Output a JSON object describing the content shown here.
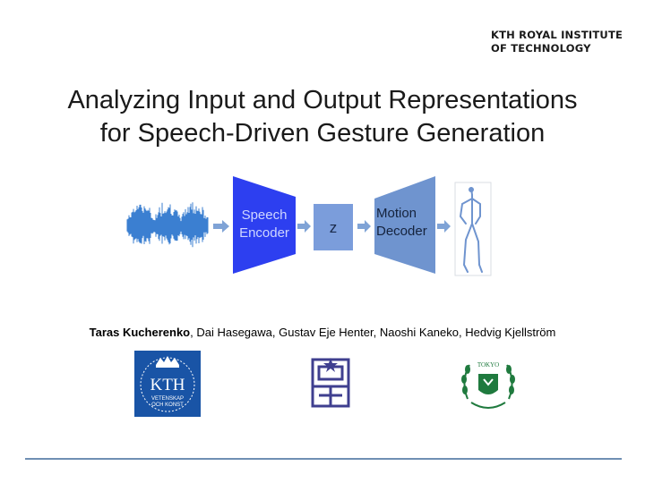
{
  "header": {
    "institution_line1": "KTH ROYAL INSTITUTE",
    "institution_line2": "OF TECHNOLOGY"
  },
  "title": {
    "line1": "Analyzing Input and Output Representations",
    "line2": "for Speech-Driven Gesture Generation"
  },
  "diagram": {
    "encoder_line1": "Speech",
    "encoder_line2": "Encoder",
    "latent": "z",
    "decoder_line1": "Motion",
    "decoder_line2": "Decoder"
  },
  "authors": {
    "lead": "Taras Kucherenko",
    "rest": ", Dai Hasegawa, Gustav Eje Henter, Naoshi Kaneko, Hedvig Kjellström"
  },
  "logos": {
    "kth_text": "KTH",
    "kth_sub1": "VETENSKAP",
    "kth_sub2": "OCH KONST",
    "tokyo_text": "TOKYO"
  },
  "colors": {
    "encoder": "#2d3ff0",
    "decoder": "#6f94cf",
    "latent": "#7b9ddb",
    "arrow": "#7fa3d6",
    "waveform": "#3b7fd1",
    "kth_blue": "#1954a6",
    "purple_logo": "#3f3f8f",
    "green_logo": "#1f7a3e"
  }
}
